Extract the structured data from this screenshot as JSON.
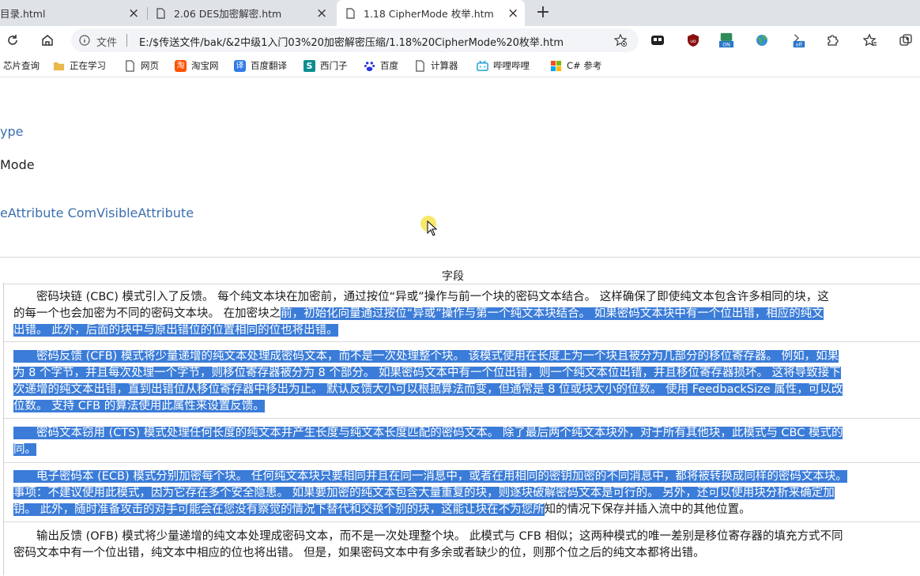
{
  "tabs": [
    {
      "label": "目录.html"
    },
    {
      "label": "2.06 DES加密解密.htm"
    },
    {
      "label": "1.18 CipherMode 枚举.htm",
      "active": true
    }
  ],
  "address": {
    "file_label": "文件",
    "url": "E:/$传送文件/bak/&2中级1入门03%20加密解密压缩/1.18%20CipherMode%20枚举.htm"
  },
  "bookmarks": [
    {
      "label": "芯片查询",
      "icon": "none"
    },
    {
      "label": "正在学习",
      "icon": "folder-icon"
    },
    {
      "label": "网页",
      "icon": "page-icon"
    },
    {
      "label": "淘宝网",
      "icon": "taobao-icon"
    },
    {
      "label": "百度翻译",
      "icon": "baidu-translate-icon"
    },
    {
      "label": "西门子",
      "icon": "siemens-icon"
    },
    {
      "label": "百度",
      "icon": "baidu-icon"
    },
    {
      "label": "计算器",
      "icon": "page-icon"
    },
    {
      "label": "哔哩哔哩",
      "icon": "bilibili-icon"
    },
    {
      "label": "C# 参考",
      "icon": "microsoft-icon"
    }
  ],
  "page": {
    "link_type": "ype",
    "mode_text": "Mode",
    "attributes_link": "eAttribute ComVisibleAttribute",
    "column_header": "字段",
    "rows": [
      {
        "lines": [
          {
            "pre": "　　密码块链 (CBC) 模式引入了反馈。 每个纯文本块在加密前，通过按位“异或”操作与前一个块的密码文本结合。 这样确保了即使纯文本包含许多相同的块，这",
            "sel": ""
          },
          {
            "pre": "的每一个也会加密为不同的密码文本块。 在加密块之",
            "sel": "前，初始化向量通过按位“异或”操作与第一个纯文本块结合。 如果密码文本块中有一个位出错，相应的纯文"
          },
          {
            "pre": "",
            "sel": "出错。 此外，后面的块中与原出错位的位置相同的位也将出错。"
          }
        ]
      },
      {
        "lines": [
          {
            "pre": "",
            "sel": "　　密码反馈 (CFB) 模式将少量递增的纯文本处理成密码文本，而不是一次处理整个块。 该模式使用在长度上为一个块且被分为几部分的移位寄存器。 例如，如果"
          },
          {
            "pre": "",
            "sel": "为 8 个字节，并且每次处理一个字节，则移位寄存器被分为 8 个部分。 如果密码文本中有一个位出错，则一个纯文本位出错，并且移位寄存器损坏。 这将导致接下"
          },
          {
            "pre": "",
            "sel": "次递增的纯文本出错，直到出错位从移位寄存器中移出为止。 默认反馈大小可以根据算法而变，但通常是 8 位或块大小的位数。 使用 FeedbackSize 属性，可以改"
          },
          {
            "pre": "",
            "sel": "位数。 支持 CFB 的算法使用此属性来设置反馈。"
          }
        ]
      },
      {
        "lines": [
          {
            "pre": "",
            "sel": "　　密码文本窃用 (CTS) 模式处理任何长度的纯文本并产生长度与纯文本长度匹配的密码文本。 除了最后两个纯文本块外，对于所有其他块，此模式与 CBC 模式的"
          },
          {
            "pre": "",
            "sel": "同。"
          }
        ]
      },
      {
        "lines": [
          {
            "pre": "",
            "sel": "　　电子密码本 (ECB) 模式分别加密每个块。 任何纯文本块只要相同并且在同一消息中，或者在用相同的密钥加密的不同消息中，都将被转换成同样的密码文本块。"
          },
          {
            "pre": "",
            "sel": "事项：不建议使用此模式，因为它存在多个安全隐患。 如果要加密的纯文本包含大量重复的块，则逐块破解密码文本是可行的。 另外，还可以使用块分析来确定加"
          },
          {
            "pre": "",
            "sel": "钥。 此外，随时准备攻击的对手可能会在您没有察觉的情况下替代和交换个别的块，这能让块在不为您所",
            "post": "知的情况下保存并插入流中的其他位置。"
          }
        ]
      },
      {
        "lines": [
          {
            "pre": "　　输出反馈 (OFB) 模式将少量递增的纯文本处理成密码文本，而不是一次处理整个块。 此模式与 CFB 相似；这两种模式的唯一差别是移位寄存器的填充方式不同",
            "sel": ""
          },
          {
            "pre": "密码文本中有一个位出错，纯文本中相应的位也将出错。 但是，如果密码文本中有多余或者缺少的位，则那个位之后的纯文本都将出错。",
            "sel": ""
          }
        ]
      }
    ]
  },
  "colors": {
    "selection": "#3b7cd8",
    "link": "#3b6fae",
    "tabstrip": "#dfe3e8"
  }
}
